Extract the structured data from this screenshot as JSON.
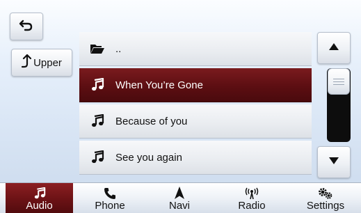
{
  "toolbar": {
    "back_icon": "back-arrow-icon",
    "upper_label": "Upper",
    "upper_icon": "up-arrow-icon"
  },
  "file_list": {
    "items": [
      {
        "label": "..",
        "icon": "folder-open-icon",
        "selected": false
      },
      {
        "label": "When You’re Gone",
        "icon": "music-note-icon",
        "selected": true
      },
      {
        "label": "Because of you",
        "icon": "music-note-icon",
        "selected": false
      },
      {
        "label": "See you again",
        "icon": "music-note-icon",
        "selected": false
      }
    ]
  },
  "scrollbar": {
    "up_icon": "triangle-up-icon",
    "down_icon": "triangle-down-icon",
    "position": 0
  },
  "nav": {
    "items": [
      {
        "label": "Audio",
        "icon": "music-note-icon",
        "active": true
      },
      {
        "label": "Phone",
        "icon": "phone-icon",
        "active": false
      },
      {
        "label": "Navi",
        "icon": "navigation-arrow-icon",
        "active": false
      },
      {
        "label": "Radio",
        "icon": "radio-signal-icon",
        "active": false
      },
      {
        "label": "Settings",
        "icon": "gears-icon",
        "active": false
      }
    ]
  },
  "colors": {
    "selection": "#5c0e12",
    "accent_active": "#6b1215",
    "background": "#dbe7f6"
  }
}
